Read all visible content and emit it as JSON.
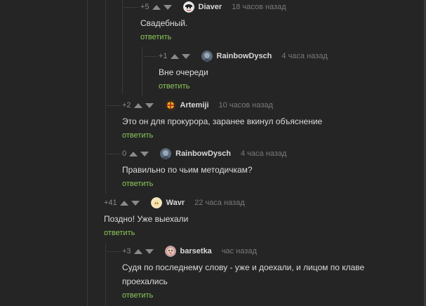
{
  "reply_label": "ответить",
  "accent": "#8ac858",
  "comments": [
    {
      "rating": "+5",
      "author": "Diaver",
      "time": "18 часов назад",
      "text": "Свадебный.",
      "avatar": "avatar-diaver"
    },
    {
      "rating": "+1",
      "author": "RainbowDysch",
      "time": "4 часа назад",
      "text": "Вне очереди",
      "avatar": "avatar-rainbowdysch"
    },
    {
      "rating": "+2",
      "author": "Artemiji",
      "time": "10 часов назад",
      "text": "Это он для прокурора, заранее вкинул объяснение",
      "avatar": "avatar-artemiji"
    },
    {
      "rating": "0",
      "author": "RainbowDysch",
      "time": "4 часа назад",
      "text": "Правильно по чьим методичкам?",
      "avatar": "avatar-rainbowdysch"
    },
    {
      "rating": "+41",
      "author": "Wavr",
      "time": "22 часа назад",
      "text": "Поздно! Уже выехали",
      "avatar": "avatar-wavr"
    },
    {
      "rating": "+3",
      "author": "barsetka",
      "time": "час назад",
      "text": "Судя по последнему слову - уже и доехали, и лицом по клаве\nпроехались",
      "avatar": "avatar-barsetka"
    }
  ]
}
